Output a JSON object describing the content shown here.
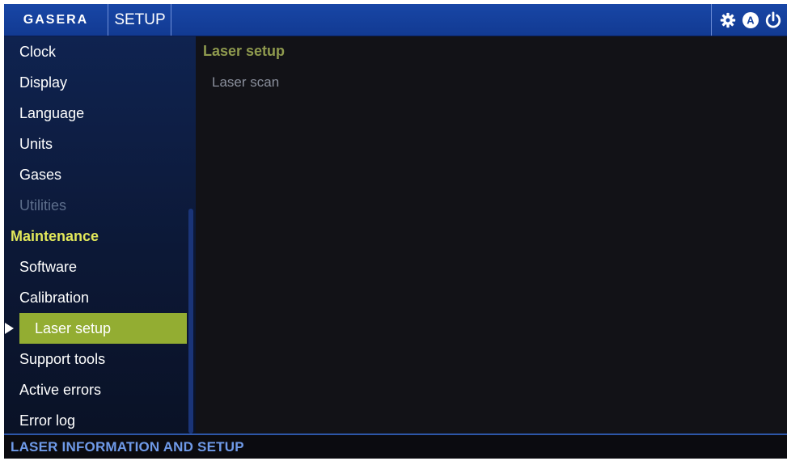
{
  "header": {
    "logo": "GASERA",
    "title": "SETUP",
    "icons": [
      "gear-icon",
      "auto-mode-icon",
      "power-icon"
    ]
  },
  "sidebar": {
    "items": [
      {
        "label": "Clock",
        "state": "normal"
      },
      {
        "label": "Display",
        "state": "normal"
      },
      {
        "label": "Language",
        "state": "normal"
      },
      {
        "label": "Units",
        "state": "normal"
      },
      {
        "label": "Gases",
        "state": "normal"
      },
      {
        "label": "Utilities",
        "state": "disabled"
      },
      {
        "label": "Maintenance",
        "state": "section"
      },
      {
        "label": "Software",
        "state": "normal"
      },
      {
        "label": "Calibration",
        "state": "normal"
      },
      {
        "label": "Laser setup",
        "state": "selected"
      },
      {
        "label": "Support tools",
        "state": "normal"
      },
      {
        "label": "Active errors",
        "state": "normal"
      },
      {
        "label": "Error log",
        "state": "normal"
      }
    ]
  },
  "content": {
    "title": "Laser setup",
    "items": [
      "Laser scan"
    ]
  },
  "footer": {
    "status": "LASER INFORMATION AND SETUP"
  },
  "colors": {
    "header_blue": "#1846a6",
    "section_yellow": "#e2e85a",
    "selected_green": "#93ad32",
    "footer_text_blue": "#6f9ae8"
  },
  "auto_mode_badge": "A"
}
